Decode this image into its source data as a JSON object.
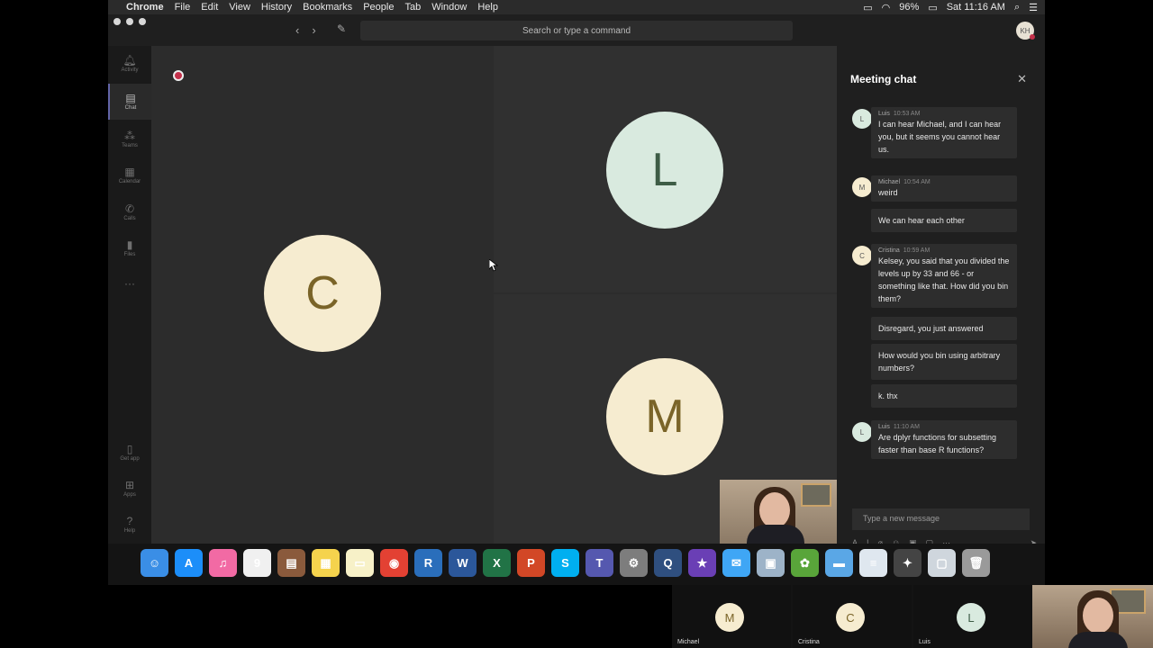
{
  "menubar": {
    "app": "Chrome",
    "items": [
      "File",
      "Edit",
      "View",
      "History",
      "Bookmarks",
      "People",
      "Tab",
      "Window",
      "Help"
    ],
    "battery": "96%",
    "clock": "Sat 11:16 AM"
  },
  "titlebar": {
    "search_placeholder": "Search or type a command",
    "profile_initials": "KH"
  },
  "rail": [
    {
      "icon": "bell-icon",
      "label": "Activity"
    },
    {
      "icon": "chat-icon",
      "label": "Chat"
    },
    {
      "icon": "teams-icon",
      "label": "Teams"
    },
    {
      "icon": "calendar-icon",
      "label": "Calendar"
    },
    {
      "icon": "phone-icon",
      "label": "Calls"
    },
    {
      "icon": "files-icon",
      "label": "Files"
    },
    {
      "icon": "more-icon",
      "label": ""
    },
    {
      "icon": "mobile-icon",
      "label": "Get app"
    },
    {
      "icon": "apps-icon",
      "label": "Apps"
    },
    {
      "icon": "help-icon",
      "label": "Help"
    }
  ],
  "stage": {
    "main_avatar": "C",
    "top_avatar": "L",
    "bottom_avatar": "M",
    "colors": {
      "cream": "#f6ecd0",
      "mint": "#d9eadf"
    }
  },
  "chat": {
    "title": "Meeting chat",
    "messages": [
      {
        "author": "Luis",
        "time": "10:53 AM",
        "initial": "L",
        "text": "I can hear Michael, and I can hear you, but it seems you cannot hear us."
      },
      {
        "author": "Michael",
        "time": "10:54 AM",
        "initial": "M",
        "text": "weird"
      },
      {
        "author": "",
        "time": "",
        "initial": "",
        "text": "We can hear each other"
      },
      {
        "author": "Cristina",
        "time": "10:59 AM",
        "initial": "C",
        "text": "Kelsey, you said that you divided the levels up by 33 and 66 - or something like that. How did you bin them?"
      },
      {
        "author": "",
        "time": "",
        "initial": "",
        "text": "Disregard, you just answered"
      },
      {
        "author": "",
        "time": "",
        "initial": "",
        "text": "How would you bin using arbitrary numbers?"
      },
      {
        "author": "",
        "time": "",
        "initial": "",
        "text": "k. thx"
      },
      {
        "author": "Luis",
        "time": "11:10 AM",
        "initial": "L",
        "text": "Are dplyr functions for subsetting faster than base R functions?"
      }
    ],
    "composer_placeholder": "Type a new message"
  },
  "dock": [
    {
      "icon": "finder-icon",
      "glyph": "☺",
      "color": "#3a8ee6"
    },
    {
      "icon": "app-store-icon",
      "glyph": "A",
      "color": "#1c8ef9"
    },
    {
      "icon": "itunes-icon",
      "glyph": "♫",
      "color": "#f26aa4"
    },
    {
      "icon": "calendar-app-icon",
      "glyph": "9",
      "color": "#f0f0f0"
    },
    {
      "icon": "notebook-icon",
      "glyph": "▤",
      "color": "#8a5a3c"
    },
    {
      "icon": "stickies-icon",
      "glyph": "▦",
      "color": "#f5d34d"
    },
    {
      "icon": "notes-icon",
      "glyph": "▭",
      "color": "#f7f1c8"
    },
    {
      "icon": "chrome-icon",
      "glyph": "◉",
      "color": "#e34133"
    },
    {
      "icon": "r-icon",
      "glyph": "R",
      "color": "#2a6ebb"
    },
    {
      "icon": "word-icon",
      "glyph": "W",
      "color": "#2b579a"
    },
    {
      "icon": "excel-icon",
      "glyph": "X",
      "color": "#217346"
    },
    {
      "icon": "powerpoint-icon",
      "glyph": "P",
      "color": "#d24726"
    },
    {
      "icon": "skype-icon",
      "glyph": "S",
      "color": "#00aff0"
    },
    {
      "icon": "teams-app-icon",
      "glyph": "T",
      "color": "#5558af"
    },
    {
      "icon": "system-prefs-icon",
      "glyph": "⚙",
      "color": "#7d7d7d"
    },
    {
      "icon": "quicktime-icon",
      "glyph": "Q",
      "color": "#2f4f7f"
    },
    {
      "icon": "imovie-icon",
      "glyph": "★",
      "color": "#6a3fb5"
    },
    {
      "icon": "messages-icon",
      "glyph": "✉",
      "color": "#3fa6f5"
    },
    {
      "icon": "preview-icon",
      "glyph": "▣",
      "color": "#9db3c8"
    },
    {
      "icon": "android-file-icon",
      "glyph": "✿",
      "color": "#59a53a"
    },
    {
      "icon": "folder-icon",
      "glyph": "▬",
      "color": "#5aa7e6"
    },
    {
      "icon": "textedit-icon",
      "glyph": "≡",
      "color": "#dfe7ef"
    },
    {
      "icon": "tools-icon",
      "glyph": "✦",
      "color": "#444"
    },
    {
      "icon": "screens-icon",
      "glyph": "▢",
      "color": "#cfd6dd"
    },
    {
      "icon": "trash-icon",
      "glyph": "🗑",
      "color": "#9a9a9a"
    }
  ],
  "participants": [
    {
      "name": "Michael",
      "initial": "M"
    },
    {
      "name": "Cristina",
      "initial": "C"
    },
    {
      "name": "Luis",
      "initial": "L"
    }
  ]
}
